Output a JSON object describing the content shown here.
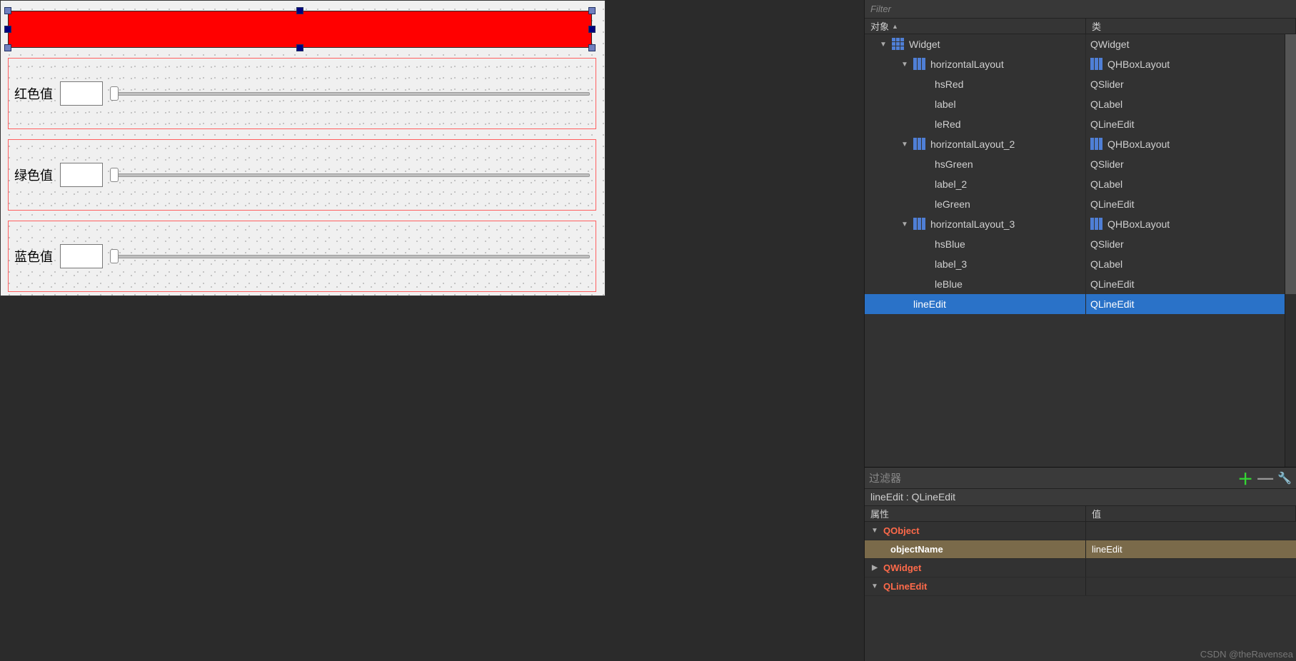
{
  "designer": {
    "labels": {
      "red": "红色值",
      "green": "绿色值",
      "blue": "蓝色值"
    },
    "selected_color": "#ff0000"
  },
  "objectInspector": {
    "filterPlaceholder": "Filter",
    "columns": {
      "object": "对象",
      "class": "类"
    },
    "tree": [
      {
        "depth": 0,
        "name": "Widget",
        "class": "QWidget",
        "icon": "grid",
        "expander": "▼"
      },
      {
        "depth": 1,
        "name": "horizontalLayout",
        "class": "QHBoxLayout",
        "icon": "hbox",
        "classIcon": "hbox",
        "expander": "▼"
      },
      {
        "depth": 2,
        "name": "hsRed",
        "class": "QSlider"
      },
      {
        "depth": 2,
        "name": "label",
        "class": "QLabel"
      },
      {
        "depth": 2,
        "name": "leRed",
        "class": "QLineEdit"
      },
      {
        "depth": 1,
        "name": "horizontalLayout_2",
        "class": "QHBoxLayout",
        "icon": "hbox",
        "classIcon": "hbox",
        "expander": "▼"
      },
      {
        "depth": 2,
        "name": "hsGreen",
        "class": "QSlider"
      },
      {
        "depth": 2,
        "name": "label_2",
        "class": "QLabel"
      },
      {
        "depth": 2,
        "name": "leGreen",
        "class": "QLineEdit"
      },
      {
        "depth": 1,
        "name": "horizontalLayout_3",
        "class": "QHBoxLayout",
        "icon": "hbox",
        "classIcon": "hbox",
        "expander": "▼"
      },
      {
        "depth": 2,
        "name": "hsBlue",
        "class": "QSlider"
      },
      {
        "depth": 2,
        "name": "label_3",
        "class": "QLabel"
      },
      {
        "depth": 2,
        "name": "leBlue",
        "class": "QLineEdit"
      },
      {
        "depth": 1,
        "name": "lineEdit",
        "class": "QLineEdit",
        "selected": true
      }
    ]
  },
  "propertyEditor": {
    "filterPlaceholder": "过滤器",
    "breadcrumb": "lineEdit : QLineEdit",
    "columns": {
      "property": "属性",
      "value": "值"
    },
    "groups": [
      {
        "name": "QObject",
        "expanded": true,
        "class": "qobject",
        "rows": [
          {
            "name": "objectName",
            "value": "lineEdit",
            "highlight": true
          }
        ]
      },
      {
        "name": "QWidget",
        "expanded": false,
        "class": "qwidget",
        "rows": []
      },
      {
        "name": "QLineEdit",
        "expanded": true,
        "class": "qlineedit",
        "rows": []
      }
    ]
  },
  "watermark": "CSDN @theRavensea"
}
